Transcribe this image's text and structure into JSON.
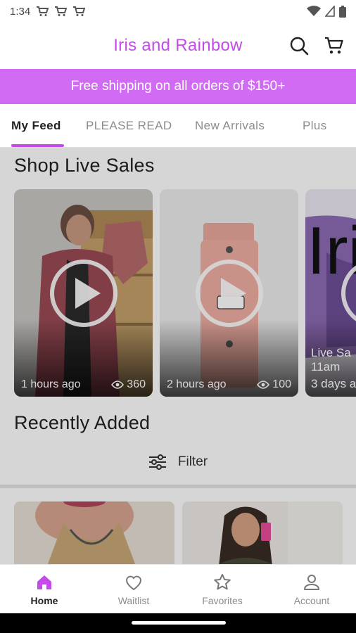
{
  "status_bar": {
    "time": "1:34"
  },
  "header": {
    "title": "Iris and Rainbow"
  },
  "banner": {
    "text": "Free shipping on all orders of $150+"
  },
  "tabs": [
    {
      "label": "My Feed",
      "active": true
    },
    {
      "label": "PLEASE READ",
      "active": false
    },
    {
      "label": "New Arrivals",
      "active": false
    },
    {
      "label": "Plus",
      "active": false
    }
  ],
  "live_sales": {
    "title": "Shop Live Sales",
    "cards": [
      {
        "time": "1 hours ago",
        "views": "360"
      },
      {
        "time": "2 hours ago",
        "views": "100"
      },
      {
        "line1": "Live Sa",
        "line2": "11am",
        "time": "3 days a",
        "logo_text": "Iri"
      }
    ]
  },
  "recently_added": {
    "title": "Recently Added",
    "filter_label": "Filter"
  },
  "bottom_nav": [
    {
      "label": "Home",
      "icon": "home-icon",
      "active": true
    },
    {
      "label": "Waitlist",
      "icon": "heart-icon",
      "active": false
    },
    {
      "label": "Favorites",
      "icon": "star-icon",
      "active": false
    },
    {
      "label": "Account",
      "icon": "person-icon",
      "active": false
    }
  ],
  "colors": {
    "brand": "#c44ae9",
    "banner": "#d26bf3"
  }
}
